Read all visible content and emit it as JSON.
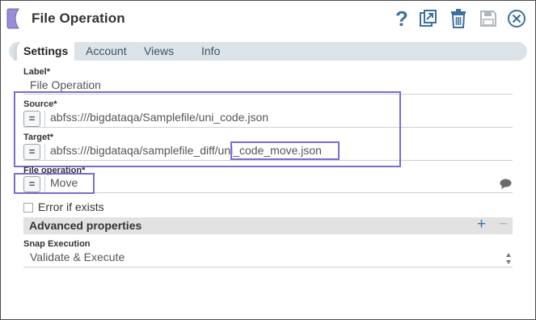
{
  "header": {
    "title": "File Operation",
    "help_glyph": "?",
    "icons": [
      "snap-logo-icon",
      "help-icon",
      "export-icon",
      "delete-icon",
      "save-icon",
      "close-icon"
    ]
  },
  "tabs": [
    {
      "label": "Settings",
      "active": true
    },
    {
      "label": "Account",
      "active": false
    },
    {
      "label": "Views",
      "active": false
    },
    {
      "label": "Info",
      "active": false
    }
  ],
  "fields": {
    "label": {
      "label": "Label*",
      "value": "File Operation"
    },
    "source": {
      "label": "Source*",
      "expr_glyph": "=",
      "value": "abfss:///bigdataqa/Samplefile/uni_code.json"
    },
    "target": {
      "label": "Target*",
      "expr_glyph": "=",
      "value_prefix": "abfss:///bigdataqa/samplefile_diff/",
      "value_highlight": "uni_code_move.json"
    },
    "file_operation": {
      "label": "File operation*",
      "expr_glyph": "=",
      "value": "Move"
    },
    "error_if_exists": {
      "label": "Error if exists",
      "checked": false
    },
    "advanced": {
      "title": "Advanced properties",
      "plus": "+",
      "minus": "−"
    },
    "snap_execution": {
      "label": "Snap Execution",
      "value": "Validate & Execute"
    }
  },
  "colors": {
    "accent": "#3d6f9c",
    "highlight_border": "#7b6ccf",
    "logo": "#9a8cd6",
    "tab_bar": "#dbe3e8"
  }
}
